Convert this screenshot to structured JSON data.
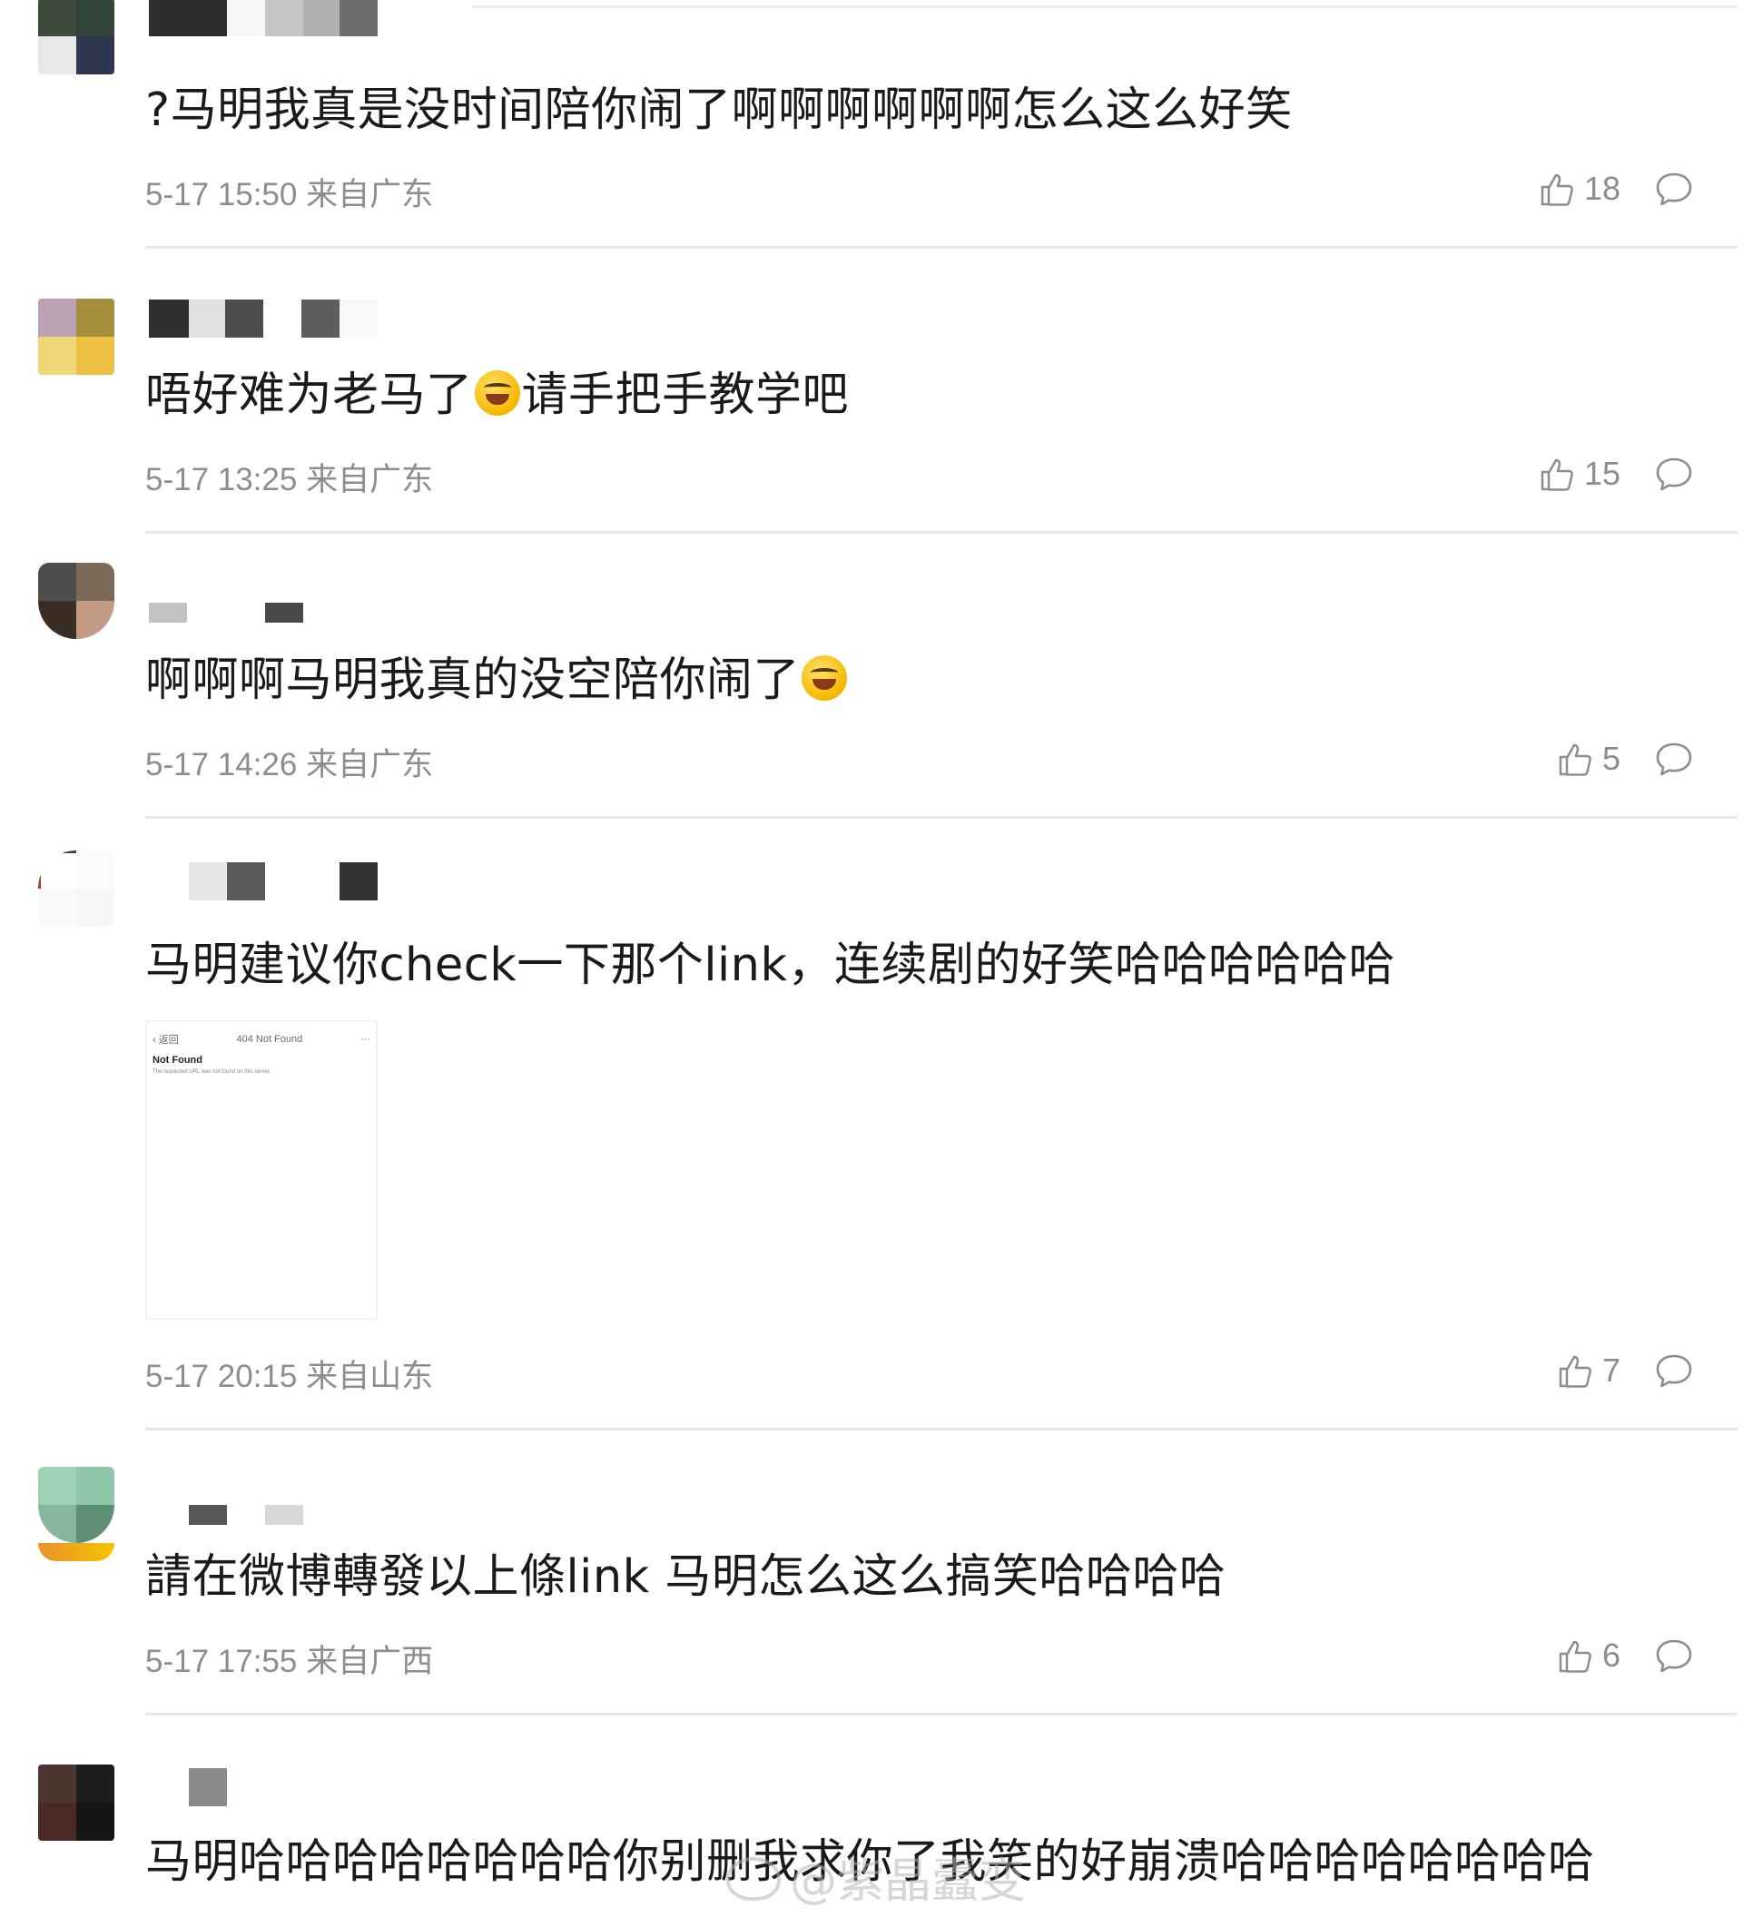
{
  "comments": [
    {
      "text_before": "?马明我真是没时间陪你闹了啊啊啊啊啊啊怎么这么好笑",
      "text_after": "",
      "emoji": "",
      "meta": "5-17 15:50 来自广东",
      "likes": "18"
    },
    {
      "text_before": "唔好难为老马了",
      "emoji": "rolling-on-floor-laughing-emoji",
      "text_after": "请手把手教学吧",
      "meta": "5-17 13:25 来自广东",
      "likes": "15"
    },
    {
      "text_before": "啊啊啊马明我真的没空陪你闹了",
      "emoji": "tears-of-joy-emoji",
      "text_after": "",
      "meta": "5-17 14:26 来自广东",
      "likes": "5"
    },
    {
      "text_before": "马明建议你check一下那个link，连续剧的好笑哈哈哈哈哈哈",
      "emoji": "",
      "text_after": "",
      "meta": "5-17 20:15 来自山东",
      "likes": "7",
      "attachment": {
        "back_label": "返回",
        "page_title": "404 Not Found",
        "more": "···",
        "heading": "Not Found",
        "body": "The requested URL was not found on this server."
      }
    },
    {
      "text_before": "請在微博轉發以上條link 马明怎么这么搞笑哈哈哈哈",
      "emoji": "",
      "text_after": "",
      "meta": "5-17 17:55 来自广西",
      "likes": "6"
    },
    {
      "text_before": "马明哈哈哈哈哈哈哈哈你别删我求你了我笑的好崩溃哈哈哈哈哈哈哈哈",
      "emoji": "",
      "text_after": "",
      "meta": "",
      "likes": ""
    }
  ],
  "watermark": "@紫晶蠹变",
  "colors": {
    "text": "#1a1a1a",
    "meta": "#8d8d8d",
    "separator": "#e8e8e8"
  },
  "icons": {
    "like": "thumbs-up-icon",
    "reply": "comment-bubble-icon"
  }
}
